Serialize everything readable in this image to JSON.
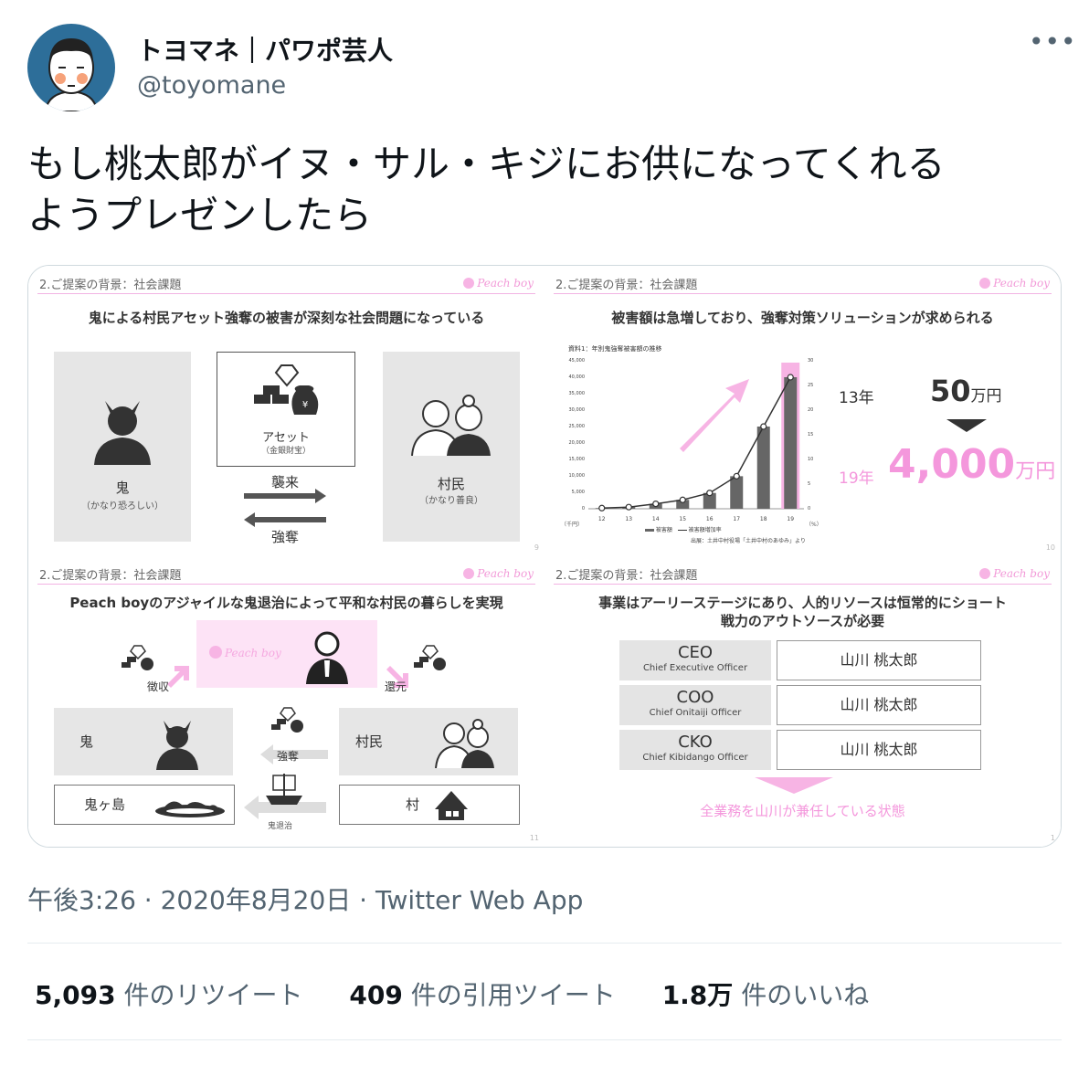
{
  "author": {
    "name": "トヨマネ｜パワポ芸人",
    "handle": "@toyomane"
  },
  "tweet": {
    "text_line1": "もし桃太郎がイヌ・サル・キジにお供になってくれる",
    "text_line2": "ようプレゼンしたら"
  },
  "slides": {
    "header": "2.ご提案の背景：社会課題",
    "logo": "Peach boy",
    "s1": {
      "title": "鬼による村民アセット強奪の被害が深刻な社会問題になっている",
      "oni": "鬼",
      "oni_sub": "（かなり恐ろしい）",
      "asset": "アセット",
      "asset_sub": "（金銀財宝）",
      "attack": "襲来",
      "rob": "強奪",
      "villager": "村民",
      "villager_sub": "（かなり善良）",
      "page": "9"
    },
    "s2": {
      "title": "被害額は急増しており、強奪対策ソリューションが求められる",
      "chart_caption": "資料1：年別鬼強奪被害額の推移",
      "legend_bar": "被害額",
      "legend_line": "被害額増加率",
      "source": "出展：土井中村役場「土井中村のあゆみ」より",
      "y13": "13年",
      "v13": "50",
      "unit": "万円",
      "y19": "19年",
      "v19": "4,000",
      "page": "10",
      "left_unit": "（千円）",
      "right_unit": "（%）"
    },
    "s3": {
      "title": "Peach boyのアジャイルな鬼退治によって平和な村民の暮らしを実現",
      "collect": "徴収",
      "return": "還元",
      "oni": "鬼",
      "villager": "村民",
      "rob": "強奪",
      "island": "鬼ヶ島",
      "village": "村",
      "extermination": "鬼退治",
      "page": "11"
    },
    "s4": {
      "title_line1": "事業はアーリーステージにあり、人的リソースは恒常的にショート",
      "title_line2": "戦力のアウトソースが必要",
      "roles": [
        {
          "abbr": "CEO",
          "full": "Chief Executive Officer",
          "person": "山川 桃太郎"
        },
        {
          "abbr": "COO",
          "full": "Chief Onitaiji Officer",
          "person": "山川 桃太郎"
        },
        {
          "abbr": "CKO",
          "full": "Chief Kibidango Officer",
          "person": "山川 桃太郎"
        }
      ],
      "footer": "全業務を山川が兼任している状態",
      "page": "1"
    }
  },
  "chart_data": {
    "type": "bar",
    "title": "資料1：年別鬼強奪被害額の推移",
    "categories": [
      "12",
      "13",
      "14",
      "15",
      "16",
      "17",
      "18",
      "19"
    ],
    "series": [
      {
        "name": "被害額",
        "values": [
          200,
          500,
          1500,
          2700,
          4800,
          9900,
          25000,
          40000
        ]
      },
      {
        "name": "被害額増加率",
        "values": [
          0.2,
          0.5,
          1.5,
          2.7,
          4.8,
          9.9,
          25,
          40
        ]
      }
    ],
    "y_ticks": [
      "45,000",
      "40,000",
      "35,000",
      "30,000",
      "25,000",
      "20,000",
      "15,000",
      "10,000",
      "5,000",
      "0"
    ],
    "y2_ticks": [
      "30",
      "25",
      "20",
      "15",
      "10",
      "5",
      "0"
    ],
    "ylim": [
      0,
      45000
    ]
  },
  "meta": {
    "timestamp": "午後3:26 · 2020年8月20日 · Twitter Web App"
  },
  "stats": {
    "retweets": "5,093",
    "retweets_label": "件のリツイート",
    "quotes": "409",
    "quotes_label": "件の引用ツイート",
    "likes": "1.8万",
    "likes_label": "件のいいね"
  },
  "colors": {
    "accent_pink": "#f497dc",
    "gray_panel": "#e6e6e6",
    "avatar_bg": "#2d6e99"
  }
}
